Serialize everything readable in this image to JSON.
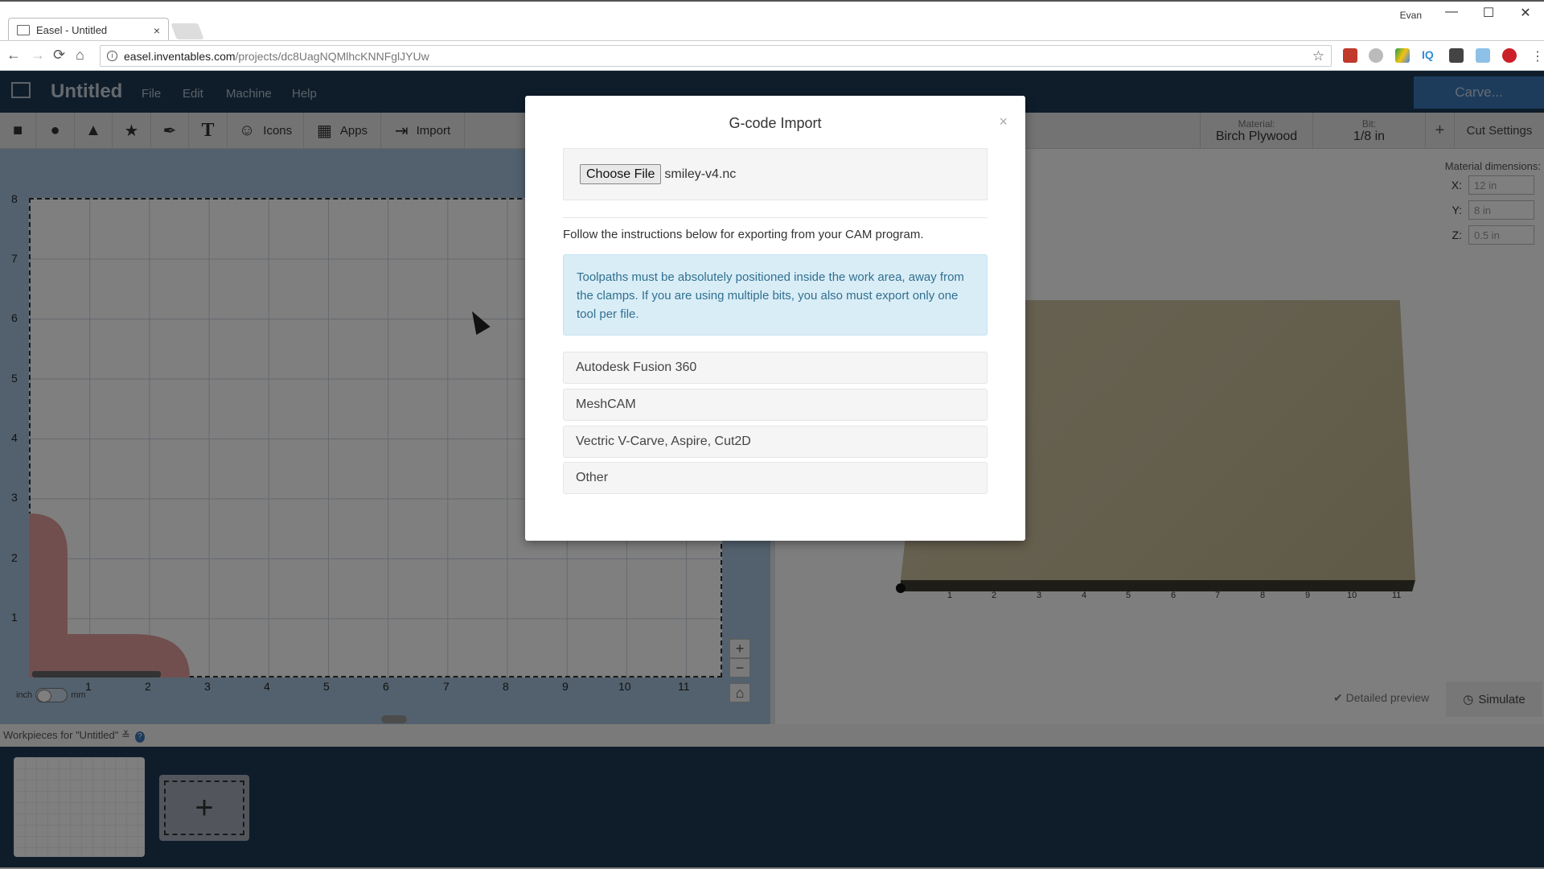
{
  "browser": {
    "tab_title": "Easel - Untitled",
    "tab_close": "×",
    "user_name": "Evan",
    "url_host": "easel.inventables.com",
    "url_path": "/projects/dc8UagNQMlhcKNNFglJYUw",
    "nav": {
      "back": "←",
      "forward": "→",
      "reload": "⟳",
      "home": "⌂"
    },
    "window_controls": {
      "minimize": "—",
      "maximize": "☐",
      "close": "✕"
    },
    "extensions": [
      "ublock-icon",
      "drive-grey-icon",
      "google-drive-icon",
      "iq-icon",
      "lightbulb-icon",
      "mail-icon",
      "pinterest-icon",
      "menu-icon"
    ]
  },
  "app": {
    "title": "Untitled",
    "menu": [
      "File",
      "Edit",
      "Machine",
      "Help"
    ],
    "carve_label": "Carve..."
  },
  "toolbar": {
    "tools": [
      {
        "name": "rectangle",
        "glyph": "■",
        "label": ""
      },
      {
        "name": "circle",
        "glyph": "●",
        "label": ""
      },
      {
        "name": "triangle",
        "glyph": "▲",
        "label": ""
      },
      {
        "name": "star",
        "glyph": "★",
        "label": ""
      },
      {
        "name": "pen",
        "glyph": "✒",
        "label": ""
      },
      {
        "name": "text",
        "glyph": "T",
        "label": ""
      },
      {
        "name": "icons",
        "glyph": "☺",
        "label": "Icons"
      },
      {
        "name": "apps",
        "glyph": "▦",
        "label": "Apps"
      },
      {
        "name": "import",
        "glyph": "⇥",
        "label": "Import"
      }
    ],
    "material_caption": "Material:",
    "material_value": "Birch Plywood",
    "bit_caption": "Bit:",
    "bit_value": "1/8 in",
    "add_label": "+",
    "cut_settings_label": "Cut Settings"
  },
  "canvas": {
    "y_ticks": [
      "8",
      "7",
      "6",
      "5",
      "4",
      "3",
      "2",
      "1"
    ],
    "x_ticks": [
      "1",
      "2",
      "3",
      "4",
      "5",
      "6",
      "7",
      "8",
      "9",
      "10",
      "11"
    ],
    "unit_left": "inch",
    "unit_right": "mm",
    "zoom_in": "+",
    "zoom_out": "−",
    "home": "⌂",
    "divider_handle": "⋮"
  },
  "preview": {
    "material_dims_title": "Material dimensions:",
    "dims": [
      {
        "axis": "X:",
        "value": "12 in"
      },
      {
        "axis": "Y:",
        "value": "8 in"
      },
      {
        "axis": "Z:",
        "value": "0.5 in"
      }
    ],
    "x_ticks": [
      "1",
      "2",
      "3",
      "4",
      "5",
      "6",
      "7",
      "8",
      "9",
      "10",
      "11"
    ],
    "detailed_preview_label": "✔ Detailed preview",
    "simulate_label": "Simulate"
  },
  "workpieces": {
    "label": "Workpieces for \"Untitled\" ≚",
    "help": "?",
    "add_glyph": "+"
  },
  "modal": {
    "title": "G-code Import",
    "close": "×",
    "choose_file_label": "Choose File",
    "file_name": "smiley-v4.nc",
    "instructions": "Follow the instructions below for exporting from your CAM program.",
    "alert": "Toolpaths must be absolutely positioned inside the work area, away from the clamps. If you are using multiple bits, you also must export only one tool per file.",
    "options": [
      "Autodesk Fusion 360",
      "MeshCAM",
      "Vectric V-Carve, Aspire, Cut2D",
      "Other"
    ]
  }
}
